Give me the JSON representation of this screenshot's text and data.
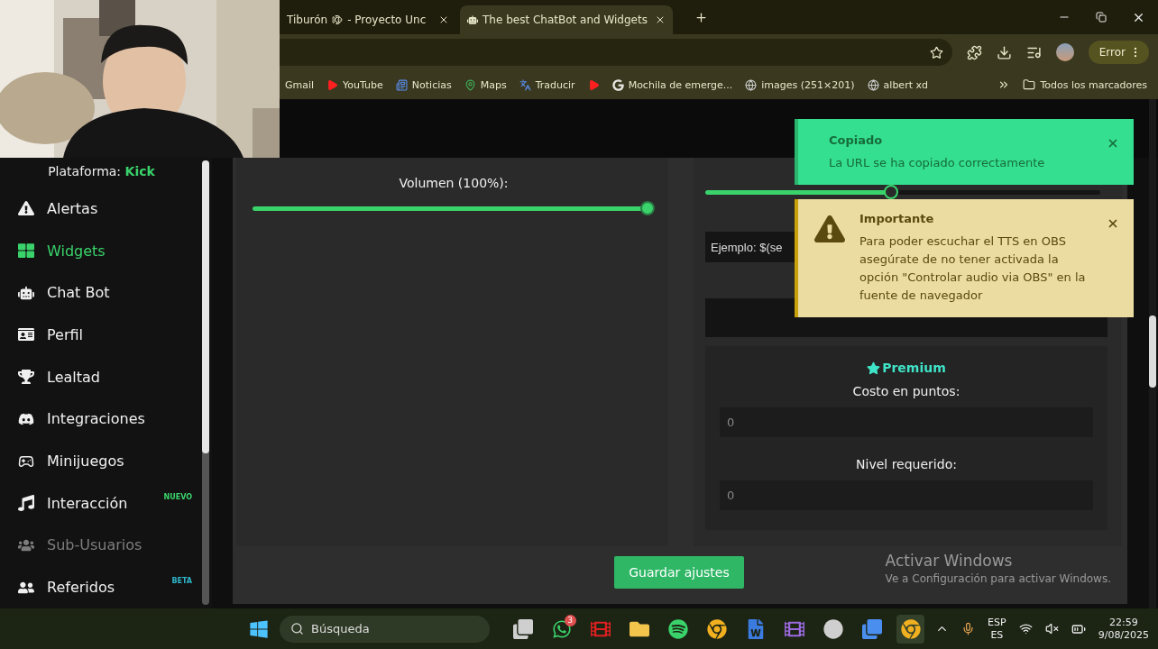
{
  "browser": {
    "tabs": [
      {
        "label": "Tiburón",
        "label_end": "- Proyecto Unc",
        "selected": false
      },
      {
        "label": "The best ChatBot and Widgets",
        "selected": true
      }
    ],
    "profile_button": "Error",
    "bookmarks": [
      {
        "label": "Gmail"
      },
      {
        "kind": "youtube",
        "label": "YouTube"
      },
      {
        "kind": "news",
        "label": "Noticias"
      },
      {
        "kind": "maps",
        "label": "Maps"
      },
      {
        "kind": "translate",
        "label": "Traducir"
      },
      {
        "kind": "youtube"
      },
      {
        "kind": "google",
        "label": "Mochila de emerge..."
      },
      {
        "kind": "globe",
        "label": "images (251×201)"
      },
      {
        "kind": "globe",
        "label": "albert xd"
      }
    ],
    "all_bookmarks": "Todos los marcadores"
  },
  "sidebar": {
    "platform_label": "Plataforma:",
    "platform": "Kick",
    "items": [
      {
        "kind": "alert",
        "label": "Alertas",
        "selected": false,
        "disabled": false
      },
      {
        "kind": "widgets",
        "label": "Widgets",
        "selected": true,
        "disabled": false
      },
      {
        "kind": "robot",
        "label": "Chat Bot",
        "selected": false,
        "disabled": false
      },
      {
        "kind": "card",
        "label": "Perfil",
        "selected": false,
        "disabled": false
      },
      {
        "kind": "trophy",
        "label": "Lealtad",
        "selected": false,
        "disabled": false
      },
      {
        "kind": "discord",
        "label": "Integraciones",
        "selected": false,
        "disabled": false
      },
      {
        "kind": "gamepad",
        "label": "Minijuegos",
        "selected": false,
        "disabled": false
      },
      {
        "kind": "music",
        "label": "Interacción",
        "selected": false,
        "disabled": false,
        "badge": "NUEVO",
        "color": "#3ad36b"
      },
      {
        "kind": "users",
        "label": "Sub-Usuarios",
        "selected": false,
        "disabled": true
      },
      {
        "kind": "friends",
        "label": "Referidos",
        "selected": false,
        "disabled": false,
        "badge": "BETA",
        "color": "#2fb5c9"
      }
    ]
  },
  "settings": {
    "volume": {
      "label": "Volumen (100%):",
      "level": 1
    },
    "reading_slider": {
      "level": 0.47
    },
    "template_input": {
      "value": "Ejemplo: $(se"
    },
    "premium": {
      "title": "Premium",
      "cost_label": "Costo en puntos:",
      "cost_placeholder": "0",
      "level_label": "Nivel requerido:",
      "level_placeholder": "0"
    },
    "save_button": "Guardar ajustes"
  },
  "toasts": [
    {
      "kind": "success",
      "title": "Copiado",
      "message": "La URL se ha copiado correctamente"
    },
    {
      "kind": "warning",
      "title": "Importante",
      "message": "Para poder escuchar el TTS en OBS asegúrate de no tener activada la opción \"Controlar audio via OBS\" en la fuente de navegador"
    }
  ],
  "activation": {
    "title": "Activar Windows",
    "message": "Ve a Configuración para activar Windows."
  },
  "taskbar": {
    "search_placeholder": "Búsqueda",
    "apps": [
      {
        "kind": "files",
        "selected": false
      },
      {
        "kind": "whatsapp",
        "badge": "3",
        "selected": false
      },
      {
        "kind": "netflix",
        "selected": false
      },
      {
        "kind": "folder",
        "selected": false
      },
      {
        "kind": "spotify",
        "selected": false
      },
      {
        "kind": "chrome",
        "selected": false
      },
      {
        "kind": "word",
        "selected": false
      },
      {
        "kind": "clapper",
        "selected": false
      },
      {
        "kind": "obs",
        "selected": false
      },
      {
        "kind": "store",
        "selected": false
      },
      {
        "kind": "chrome",
        "selected": true
      }
    ],
    "language": "ESP",
    "region": "ES",
    "time": "22:59",
    "date": "9/08/2025"
  }
}
